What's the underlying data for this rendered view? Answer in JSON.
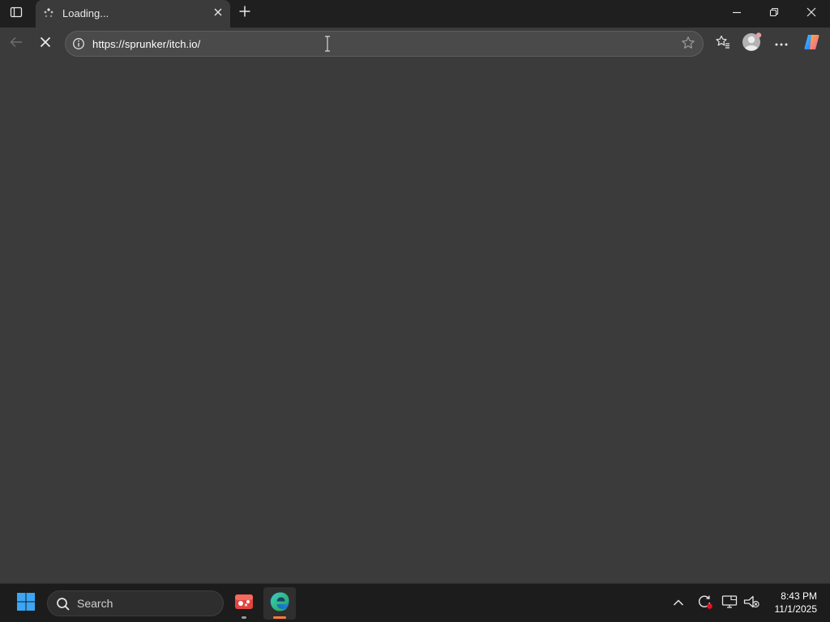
{
  "browser": {
    "tab": {
      "title": "Loading..."
    },
    "address_bar": {
      "url": "https://sprunker/itch.io/"
    }
  },
  "taskbar": {
    "search_label": "Search",
    "clock": {
      "time": "8:43 PM",
      "date": "11/1/2025"
    }
  },
  "icons": {
    "tab_actions": "tab-actions-icon",
    "loading": "loading-spinner-icon",
    "close_tab": "close-icon",
    "new_tab": "plus-icon",
    "minimize": "minimize-icon",
    "restore": "restore-icon",
    "close_window": "close-icon",
    "back": "back-arrow-icon",
    "stop": "stop-icon",
    "site_info": "info-icon",
    "favorite": "star-icon",
    "favorites": "favorites-icon",
    "profile": "profile-icon",
    "more": "more-icon",
    "copilot": "copilot-icon",
    "start": "windows-icon",
    "search": "search-icon",
    "game_app": "game-app-icon",
    "edge_app": "edge-icon",
    "tray_overflow": "chevron-up-icon",
    "tray_update": "update-icon",
    "tray_display": "display-icon",
    "tray_network": "network-off-icon"
  },
  "colors": {
    "page_background": "#3b3b3b",
    "titlebar": "#1f1f1f",
    "taskbar": "#1c1c1c",
    "accent_edge": "#ff7a3d",
    "notification_red": "#e81123"
  }
}
